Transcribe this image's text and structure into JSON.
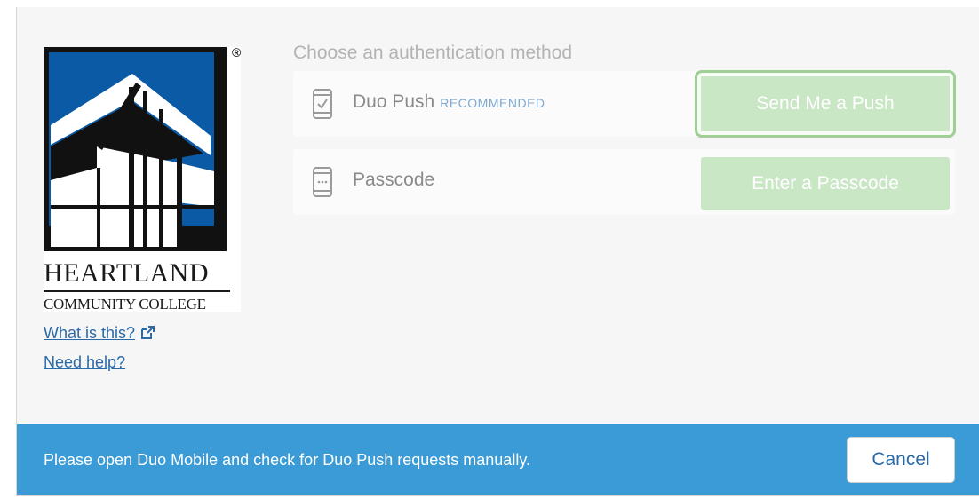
{
  "logo": {
    "name": "HEARTLAND",
    "subtitle": "COMMUNITY COLLEGE",
    "registered_mark": "®",
    "colors": {
      "blue": "#0b5aa6",
      "black": "#111111",
      "white": "#ffffff"
    }
  },
  "links": {
    "what_is_this": "What is this?",
    "need_help": "Need help?",
    "what_is_this_icon": "external-link-icon"
  },
  "auth": {
    "heading": "Choose an authentication method",
    "methods": [
      {
        "label": "Duo Push",
        "badge": "RECOMMENDED",
        "icon": "phone-check-icon",
        "button": "Send Me a Push"
      },
      {
        "label": "Passcode",
        "badge": "",
        "icon": "phone-passcode-icon",
        "button": "Enter a Passcode"
      }
    ],
    "button_color": "#c9e6c5"
  },
  "footer": {
    "message": "Please open Duo Mobile and check for Duo Push requests manually.",
    "cancel_label": "Cancel",
    "background": "#3b9bd6"
  }
}
